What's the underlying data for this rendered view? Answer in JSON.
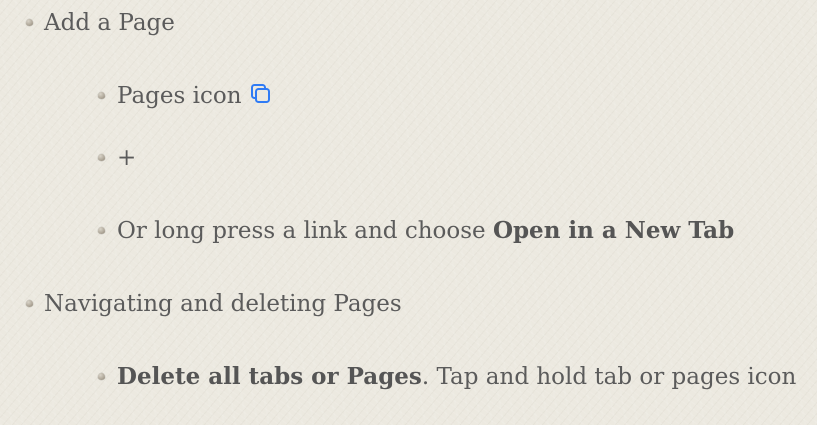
{
  "outline": {
    "add_page": {
      "label": "Add a Page",
      "items": {
        "pages_icon_label": "Pages icon",
        "plus_label": "+",
        "long_press_prefix": "Or long press a link and choose ",
        "long_press_bold": "Open in a New Tab"
      }
    },
    "navigate": {
      "label": "Navigating and deleting Pages",
      "items": {
        "delete_bold": "Delete all tabs or Pages",
        "delete_rest": ". Tap and hold tab or pages icon"
      }
    }
  },
  "icons": {
    "pages_icon": "pages-icon",
    "pages_icon_color": "#2f7bf5"
  }
}
